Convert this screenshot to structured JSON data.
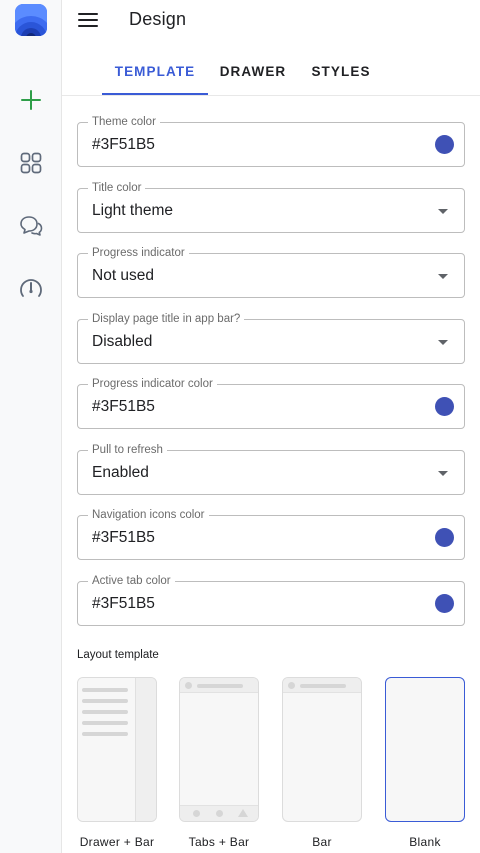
{
  "header": {
    "title": "Design"
  },
  "tabs": [
    {
      "label": "TEMPLATE",
      "active": true
    },
    {
      "label": "DRAWER",
      "active": false
    },
    {
      "label": "STYLES",
      "active": false
    }
  ],
  "fields": [
    {
      "label": "Theme color",
      "value": "#3F51B5",
      "kind": "color",
      "swatch": "#3F51B5"
    },
    {
      "label": "Title color",
      "value": "Light theme",
      "kind": "select"
    },
    {
      "label": "Progress indicator",
      "value": "Not used",
      "kind": "select"
    },
    {
      "label": "Display page title in app bar?",
      "value": "Disabled",
      "kind": "select"
    },
    {
      "label": "Progress indicator color",
      "value": "#3F51B5",
      "kind": "color",
      "swatch": "#3F51B5"
    },
    {
      "label": "Pull to refresh",
      "value": "Enabled",
      "kind": "select"
    },
    {
      "label": "Navigation icons color",
      "value": "#3F51B5",
      "kind": "color",
      "swatch": "#3F51B5"
    },
    {
      "label": "Active tab color",
      "value": "#3F51B5",
      "kind": "color",
      "swatch": "#3F51B5"
    }
  ],
  "layout": {
    "heading": "Layout template",
    "options": [
      {
        "label": "Drawer + Bar",
        "selected": false
      },
      {
        "label": "Tabs + Bar",
        "selected": false
      },
      {
        "label": "Bar",
        "selected": false
      },
      {
        "label": "Blank",
        "selected": true
      }
    ]
  },
  "rail": {
    "icons": [
      "app-logo-icon",
      "add-icon",
      "grid-icon",
      "chat-icon",
      "gauge-icon"
    ]
  },
  "colors": {
    "accent": "#3a5bd6",
    "add_green": "#2e9e48",
    "swatch": "#3F51B5"
  }
}
